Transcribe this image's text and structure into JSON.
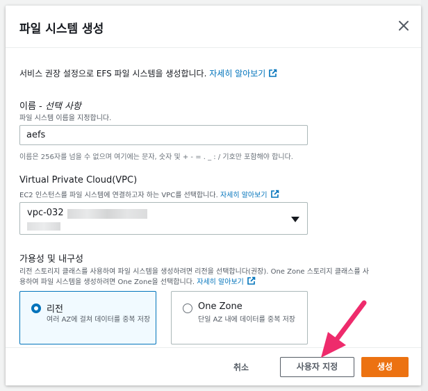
{
  "modal": {
    "title": "파일 시스템 생성",
    "intro_text": "서비스 권장 설정으로 EFS 파일 시스템을 생성합니다.",
    "intro_link": "자세히 알아보기"
  },
  "name_field": {
    "label": "이름 - ",
    "label_optional": "선택 사항",
    "description": "파일 시스템 이름을 지정합니다.",
    "value": "aefs",
    "hint": "이름은 256자를 넘을 수 없으며 여기에는 문자, 숫자 및 + - = . _ : / 기호만 포함해야 합니다."
  },
  "vpc_field": {
    "label": "Virtual Private Cloud(VPC)",
    "description": "EC2 인스턴스를 파일 시스템에 연결하고자 하는 VPC를 선택합니다.",
    "link": "자세히 알아보기",
    "selected_value": "vpc-032"
  },
  "availability": {
    "label": "가용성 및 내구성",
    "description_line1": "리전 스토리지 클래스를 사용하여 파일 시스템을 생성하려면 리전을 선택합니다(권장). One Zone 스토리지 클래스를 사",
    "description_line2": "용하여 파일 시스템을 생성하려면 One Zone을 선택합니다.",
    "link": "자세히 알아보기",
    "options": [
      {
        "title": "리전",
        "desc": "여러 AZ에 걸쳐 데이터를 중복 저장",
        "selected": true
      },
      {
        "title": "One Zone",
        "desc": "단일 AZ 내에 데이터를 중복 저장",
        "selected": false
      }
    ]
  },
  "footer": {
    "cancel": "취소",
    "customize": "사용자 지정",
    "create": "생성"
  },
  "colors": {
    "primary_button": "#ec7211",
    "link": "#0073bb",
    "arrow": "#ee2b6c"
  },
  "icons": [
    "close-icon",
    "external-link-icon",
    "caret-down-icon",
    "pointer-arrow"
  ]
}
